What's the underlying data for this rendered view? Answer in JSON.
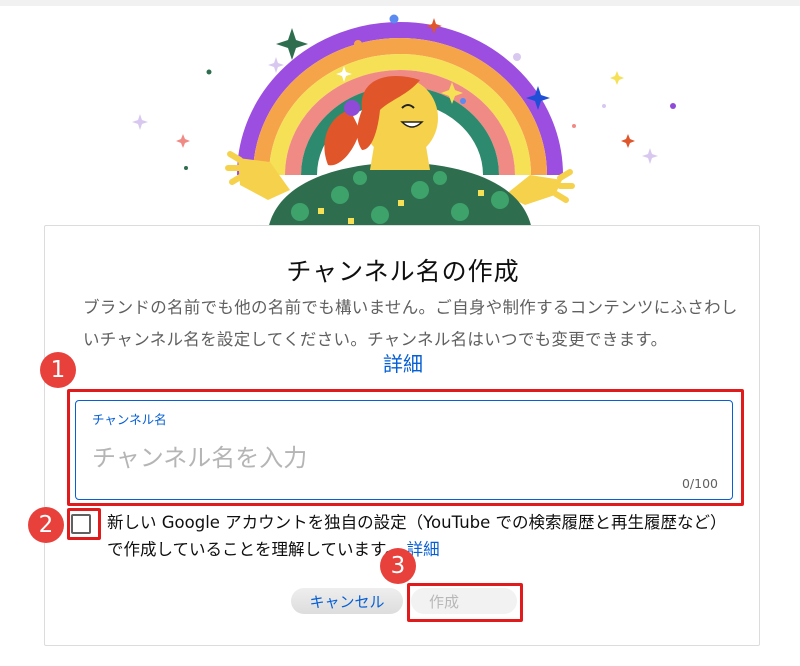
{
  "dialog": {
    "title": "チャンネル名の作成",
    "description": "ブランドの名前でも他の名前でも構いません。ご自身や制作するコンテンツにふさわしいチャンネル名を設定してください。チャンネル名はいつでも変更できます。",
    "details_link": "詳細"
  },
  "name_field": {
    "label": "チャンネル名",
    "placeholder": "チャンネル名を入力",
    "value": "",
    "counter": "0/100"
  },
  "consent": {
    "checked": false,
    "text": "新しい Google アカウントを独自の設定（YouTube での検索履歴と再生履歴など）で作成していることを理解しています。",
    "link": "詳細"
  },
  "buttons": {
    "cancel": "キャンセル",
    "create": "作成"
  },
  "annotations": {
    "step1": "1",
    "step2": "2",
    "step3": "3"
  },
  "colors": {
    "accent": "#065fd4",
    "highlight": "#e11b1b",
    "marker": "#e8413c"
  }
}
